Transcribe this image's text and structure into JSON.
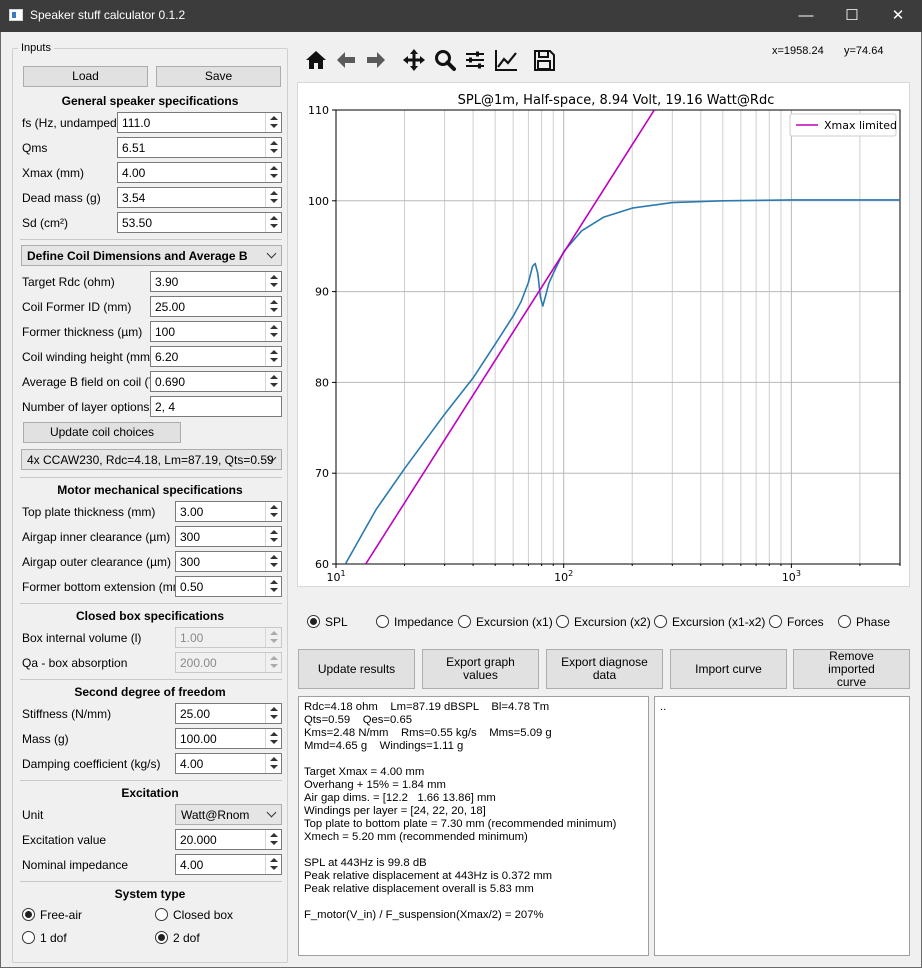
{
  "window": {
    "title": "Speaker stuff calculator 0.1.2"
  },
  "inputs": {
    "group_title": "Inputs",
    "load": "Load",
    "save": "Save"
  },
  "general": {
    "title": "General speaker specifications",
    "fields": [
      {
        "label": "fs (Hz, undamped)",
        "value": "111.0"
      },
      {
        "label": "Qms",
        "value": "6.51"
      },
      {
        "label": "Xmax (mm)",
        "value": "4.00"
      },
      {
        "label": "Dead mass (g)",
        "value": "3.54"
      },
      {
        "label": "Sd (cm²)",
        "value": "53.50"
      }
    ]
  },
  "coil": {
    "mode": "Define Coil Dimensions and Average B",
    "fields": [
      {
        "label": "Target Rdc (ohm)",
        "value": "3.90"
      },
      {
        "label": "Coil Former ID (mm)",
        "value": "25.00"
      },
      {
        "label": "Former thickness (µm)",
        "value": "100"
      },
      {
        "label": "Coil winding height (mm)",
        "value": "6.20"
      },
      {
        "label": "Average B field on coil (T)",
        "value": "0.690"
      }
    ],
    "layers_label": "Number of layer options",
    "layers_value": "2, 4",
    "update_label": "Update coil choices",
    "choice": "4x CCAW230, Rdc=4.18, Lm=87.19, Qts=0.59"
  },
  "motor": {
    "title": "Motor mechanical specifications",
    "fields": [
      {
        "label": "Top plate thickness (mm)",
        "value": "3.00"
      },
      {
        "label": "Airgap inner clearance (µm)",
        "value": "300"
      },
      {
        "label": "Airgap outer clearance (µm)",
        "value": "300"
      },
      {
        "label": "Former bottom extension (mm)",
        "value": "0.50"
      }
    ]
  },
  "closed_box": {
    "title": "Closed box specifications",
    "fields": [
      {
        "label": "Box internal volume (l)",
        "value": "1.00"
      },
      {
        "label": "Qa - box absorption",
        "value": "200.00"
      }
    ]
  },
  "second_dof": {
    "title": "Second degree of freedom",
    "fields": [
      {
        "label": "Stiffness (N/mm)",
        "value": "25.00"
      },
      {
        "label": "Mass (g)",
        "value": "100.00"
      },
      {
        "label": "Damping coefficient (kg/s)",
        "value": "4.00"
      }
    ]
  },
  "excitation": {
    "title": "Excitation",
    "unit_label": "Unit",
    "unit_value": "Watt@Rnom",
    "value_label": "Excitation value",
    "value": "20.000",
    "nominal_label": "Nominal impedance",
    "nominal_value": "4.00"
  },
  "system": {
    "title": "System type",
    "options": [
      "Free-air",
      "Closed box",
      "1 dof",
      "2 dof"
    ],
    "selected": [
      "Free-air",
      "2 dof"
    ]
  },
  "toolbar": {
    "icons": [
      "home-icon",
      "back-arrow-icon",
      "forward-arrow-icon",
      "pan-icon",
      "zoom-icon",
      "configure-subplots-icon",
      "edit-axis-icon",
      "save-icon"
    ],
    "x_readout": "x=1958.24",
    "y_readout": "y=74.64"
  },
  "graph_options": {
    "items": [
      "SPL",
      "Impedance",
      "Excursion (x1)",
      "Excursion (x2)",
      "Excursion (x1-x2)",
      "Forces",
      "Phase"
    ],
    "selected": "SPL"
  },
  "buttons": {
    "update": "Update results",
    "export_graph": "Export graph values",
    "export_diag": "Export diagnose data",
    "import": "Import curve",
    "remove": "Remove imported curve"
  },
  "results": {
    "lines": [
      "Rdc=4.18 ohm    Lm=87.19 dBSPL    Bl=4.78 Tm",
      "Qts=0.59    Qes=0.65",
      "Kms=2.48 N/mm    Rms=0.55 kg/s    Mms=5.09 g",
      "Mmd=4.65 g    Windings=1.11 g",
      "",
      "Target Xmax = 4.00 mm",
      "Overhang + 15% = 1.84 mm",
      "Air gap dims. = [12.2   1.66 13.86] mm",
      "Windings per layer = [24, 22, 20, 18]",
      "Top plate to bottom plate = 7.30 mm (recommended minimum)",
      "Xmech = 5.20 mm (recommended minimum)",
      "",
      "SPL at 443Hz is 99.8 dB",
      "Peak relative displacement at 443Hz is 0.372 mm",
      "Peak relative displacement overall is 5.83 mm",
      "",
      "F_motor(V_in) / F_suspension(Xmax/2) = 207%"
    ]
  },
  "side_output": {
    "text": ".."
  },
  "chart_data": {
    "type": "line",
    "title": "SPL@1m, Half-space, 8.94 Volt, 19.16 Watt@Rdc",
    "xscale": "log",
    "xlim": [
      10,
      3000
    ],
    "ylim": [
      60,
      110
    ],
    "xticks": [
      {
        "value": 10,
        "label": "10¹",
        "base": "10",
        "exp": "1"
      },
      {
        "value": 100,
        "label": "10²",
        "base": "10",
        "exp": "2"
      },
      {
        "value": 1000,
        "label": "10³",
        "base": "10",
        "exp": "3"
      }
    ],
    "yticks": [
      60,
      70,
      80,
      90,
      100,
      110
    ],
    "grid": true,
    "legend": "top-right",
    "series": [
      {
        "color": "#2a7ab0",
        "x": [
          11,
          15,
          20,
          30,
          40,
          50,
          60,
          65,
          70,
          73,
          75,
          77,
          79,
          81,
          83,
          86,
          90,
          100,
          120,
          150,
          200,
          300,
          500,
          1000,
          2000,
          3000
        ],
        "y": [
          60,
          66,
          70.5,
          76.5,
          80.5,
          84.2,
          87.3,
          88.9,
          91,
          92.8,
          93.1,
          92,
          89.4,
          88.4,
          89.4,
          90.9,
          92,
          94.4,
          96.7,
          98.2,
          99.2,
          99.8,
          100,
          100.1,
          100.1,
          100.1
        ]
      },
      {
        "name": "Xmax limited",
        "color": "#bf00bf",
        "x": [
          13.5,
          250
        ],
        "y": [
          60,
          110
        ]
      }
    ]
  }
}
